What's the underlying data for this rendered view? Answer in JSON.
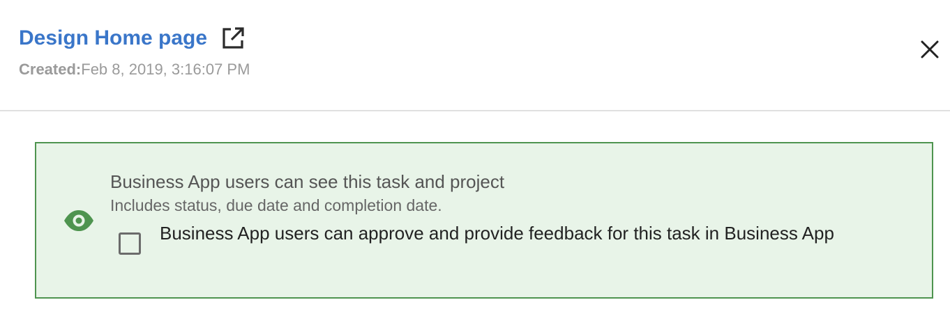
{
  "task": {
    "title": "Design Home page",
    "created_label": "Created:",
    "created_value": "Feb 8, 2019, 3:16:07 PM"
  },
  "icons": {
    "open_external": "open-in-new-icon",
    "close": "close-icon",
    "visibility": "eye-icon"
  },
  "visibility_panel": {
    "heading": "Business App users can see this task and project",
    "subtext": "Includes status, due date and completion date.",
    "approve_checkbox": {
      "label": "Business App users can approve and provide feedback for this task in Business App",
      "checked": false
    }
  },
  "colors": {
    "title": "#3a76c9",
    "panel_bg": "#e8f4e8",
    "panel_border": "#4e944f",
    "eye": "#4e944f"
  }
}
